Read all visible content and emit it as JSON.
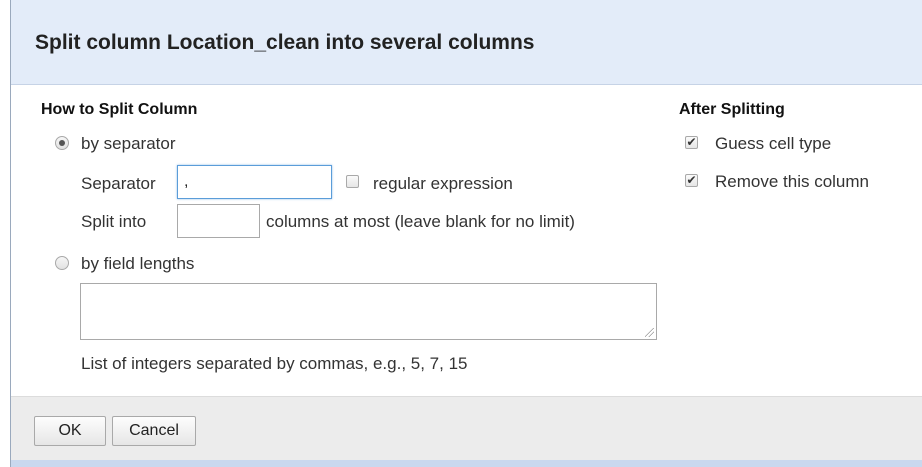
{
  "dialog": {
    "title": "Split column Location_clean into several columns"
  },
  "how_to_split": {
    "heading": "How to Split Column",
    "by_separator": {
      "label": "by separator",
      "selected": true,
      "separator_label": "Separator",
      "separator_value": ",",
      "regex_label": "regular expression",
      "regex_checked": false,
      "split_into_label": "Split into",
      "split_into_value": "",
      "split_into_suffix": "columns at most (leave blank for no limit)"
    },
    "by_field_lengths": {
      "label": "by field lengths",
      "selected": false,
      "lengths_value": "",
      "hint": "List of integers separated by commas, e.g., 5, 7, 15"
    }
  },
  "after_splitting": {
    "heading": "After Splitting",
    "guess_cell_type": {
      "label": "Guess cell type",
      "checked": true
    },
    "remove_column": {
      "label": "Remove this column",
      "checked": true
    }
  },
  "footer": {
    "ok_label": "OK",
    "cancel_label": "Cancel"
  }
}
